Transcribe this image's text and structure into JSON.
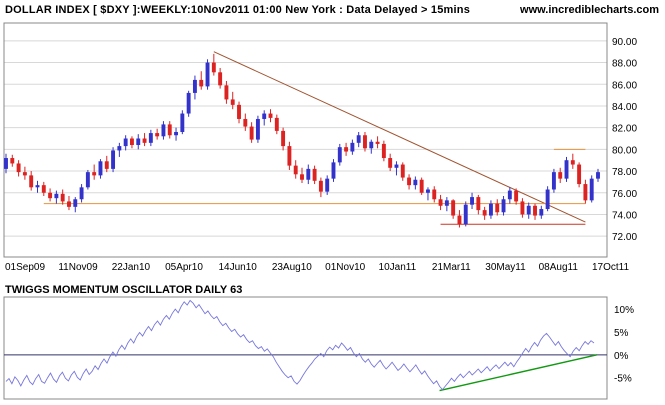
{
  "header": {
    "title": "DOLLAR INDEX [ $DXY ]:WEEKLY:10Nov2011 01:00 New York  : Data Delayed > 15mins",
    "site": "www.incrediblecharts.com"
  },
  "colors": {
    "up": "#3333cc",
    "down": "#dd2222",
    "trendline": "#a0522d",
    "support": "#e8923c",
    "oscillator": "#7777dd",
    "osc_trend": "#119911",
    "zero_line": "#333366",
    "grid": "#d8d8d8"
  },
  "chart_data": [
    {
      "type": "candlestick",
      "title": "DOLLAR INDEX [ $DXY ]:WEEKLY:10Nov2011 01:00 New York  : Data Delayed > 15mins",
      "x_tick_labels": [
        "01Sep09",
        "11Nov09",
        "22Jan10",
        "05Apr10",
        "14Jun10",
        "23Aug10",
        "01Nov10",
        "10Jan11",
        "21Mar11",
        "30May11",
        "08Aug11",
        "17Oct11"
      ],
      "y_tick_labels": [
        "72.00",
        "74.00",
        "76.00",
        "78.00",
        "80.00",
        "82.00",
        "84.00",
        "86.00",
        "88.00",
        "90.00"
      ],
      "ylim": [
        71,
        91
      ],
      "grid": true,
      "candles": [
        {
          "o": 78.2,
          "h": 79.6,
          "l": 77.8,
          "c": 79.2
        },
        {
          "o": 79.2,
          "h": 79.5,
          "l": 78.4,
          "c": 78.7
        },
        {
          "o": 78.7,
          "h": 79.0,
          "l": 77.5,
          "c": 77.9
        },
        {
          "o": 77.9,
          "h": 78.4,
          "l": 77.2,
          "c": 77.6
        },
        {
          "o": 77.6,
          "h": 78.0,
          "l": 76.2,
          "c": 76.5
        },
        {
          "o": 76.5,
          "h": 77.1,
          "l": 76.0,
          "c": 76.7
        },
        {
          "o": 76.7,
          "h": 77.0,
          "l": 75.7,
          "c": 76.0
        },
        {
          "o": 76.0,
          "h": 76.4,
          "l": 75.2,
          "c": 75.5
        },
        {
          "o": 75.5,
          "h": 76.2,
          "l": 75.0,
          "c": 75.9
        },
        {
          "o": 75.9,
          "h": 76.3,
          "l": 74.9,
          "c": 75.2
        },
        {
          "o": 75.2,
          "h": 75.7,
          "l": 74.4,
          "c": 74.7
        },
        {
          "o": 74.7,
          "h": 75.6,
          "l": 74.2,
          "c": 75.4
        },
        {
          "o": 75.4,
          "h": 76.8,
          "l": 75.1,
          "c": 76.5
        },
        {
          "o": 76.5,
          "h": 78.1,
          "l": 76.3,
          "c": 77.9
        },
        {
          "o": 77.9,
          "h": 78.6,
          "l": 77.2,
          "c": 77.6
        },
        {
          "o": 77.6,
          "h": 79.1,
          "l": 77.3,
          "c": 78.9
        },
        {
          "o": 78.9,
          "h": 79.4,
          "l": 77.9,
          "c": 78.2
        },
        {
          "o": 78.2,
          "h": 80.2,
          "l": 77.9,
          "c": 79.9
        },
        {
          "o": 79.9,
          "h": 80.6,
          "l": 79.3,
          "c": 80.3
        },
        {
          "o": 80.3,
          "h": 81.3,
          "l": 79.9,
          "c": 81.0
        },
        {
          "o": 81.0,
          "h": 81.2,
          "l": 80.1,
          "c": 80.4
        },
        {
          "o": 80.4,
          "h": 81.4,
          "l": 80.0,
          "c": 81.0
        },
        {
          "o": 81.0,
          "h": 81.5,
          "l": 80.3,
          "c": 80.6
        },
        {
          "o": 80.6,
          "h": 81.8,
          "l": 80.3,
          "c": 81.5
        },
        {
          "o": 81.5,
          "h": 81.9,
          "l": 80.9,
          "c": 81.2
        },
        {
          "o": 81.2,
          "h": 82.6,
          "l": 80.9,
          "c": 82.3
        },
        {
          "o": 82.3,
          "h": 82.6,
          "l": 81.0,
          "c": 81.3
        },
        {
          "o": 81.3,
          "h": 82.0,
          "l": 80.8,
          "c": 81.6
        },
        {
          "o": 81.6,
          "h": 83.6,
          "l": 81.4,
          "c": 83.3
        },
        {
          "o": 83.3,
          "h": 85.4,
          "l": 83.0,
          "c": 85.2
        },
        {
          "o": 85.2,
          "h": 86.8,
          "l": 84.6,
          "c": 86.4
        },
        {
          "o": 86.4,
          "h": 87.2,
          "l": 85.5,
          "c": 85.8
        },
        {
          "o": 85.8,
          "h": 88.3,
          "l": 85.5,
          "c": 88.0
        },
        {
          "o": 88.0,
          "h": 88.8,
          "l": 86.8,
          "c": 87.1
        },
        {
          "o": 87.1,
          "h": 87.5,
          "l": 85.6,
          "c": 85.9
        },
        {
          "o": 85.9,
          "h": 86.3,
          "l": 84.2,
          "c": 84.6
        },
        {
          "o": 84.6,
          "h": 85.3,
          "l": 83.7,
          "c": 84.1
        },
        {
          "o": 84.1,
          "h": 84.4,
          "l": 82.4,
          "c": 82.8
        },
        {
          "o": 82.8,
          "h": 83.3,
          "l": 81.7,
          "c": 82.1
        },
        {
          "o": 82.1,
          "h": 82.5,
          "l": 80.6,
          "c": 80.9
        },
        {
          "o": 80.9,
          "h": 83.1,
          "l": 80.6,
          "c": 82.8
        },
        {
          "o": 82.8,
          "h": 83.6,
          "l": 82.2,
          "c": 83.3
        },
        {
          "o": 83.3,
          "h": 83.7,
          "l": 82.5,
          "c": 82.9
        },
        {
          "o": 82.9,
          "h": 83.2,
          "l": 81.4,
          "c": 81.7
        },
        {
          "o": 81.7,
          "h": 82.0,
          "l": 79.9,
          "c": 80.3
        },
        {
          "o": 80.3,
          "h": 80.7,
          "l": 78.1,
          "c": 78.5
        },
        {
          "o": 78.5,
          "h": 79.0,
          "l": 77.3,
          "c": 77.7
        },
        {
          "o": 77.7,
          "h": 78.3,
          "l": 76.9,
          "c": 77.2
        },
        {
          "o": 77.2,
          "h": 78.6,
          "l": 76.8,
          "c": 78.2
        },
        {
          "o": 78.2,
          "h": 78.5,
          "l": 76.8,
          "c": 77.1
        },
        {
          "o": 77.1,
          "h": 77.4,
          "l": 75.6,
          "c": 76.1
        },
        {
          "o": 76.1,
          "h": 77.6,
          "l": 75.8,
          "c": 77.3
        },
        {
          "o": 77.3,
          "h": 79.1,
          "l": 77.0,
          "c": 78.8
        },
        {
          "o": 78.8,
          "h": 80.5,
          "l": 78.5,
          "c": 80.2
        },
        {
          "o": 80.2,
          "h": 80.6,
          "l": 79.4,
          "c": 79.8
        },
        {
          "o": 79.8,
          "h": 80.9,
          "l": 79.5,
          "c": 80.6
        },
        {
          "o": 80.6,
          "h": 81.6,
          "l": 80.2,
          "c": 81.3
        },
        {
          "o": 81.3,
          "h": 81.6,
          "l": 79.8,
          "c": 80.1
        },
        {
          "o": 80.1,
          "h": 80.9,
          "l": 79.6,
          "c": 80.7
        },
        {
          "o": 80.7,
          "h": 81.2,
          "l": 80.1,
          "c": 80.5
        },
        {
          "o": 80.5,
          "h": 80.8,
          "l": 78.9,
          "c": 79.2
        },
        {
          "o": 79.2,
          "h": 79.6,
          "l": 78.0,
          "c": 78.3
        },
        {
          "o": 78.3,
          "h": 78.9,
          "l": 77.6,
          "c": 78.6
        },
        {
          "o": 78.6,
          "h": 78.8,
          "l": 77.1,
          "c": 77.4
        },
        {
          "o": 77.4,
          "h": 77.7,
          "l": 76.3,
          "c": 76.7
        },
        {
          "o": 76.7,
          "h": 77.5,
          "l": 76.3,
          "c": 77.2
        },
        {
          "o": 77.2,
          "h": 77.4,
          "l": 75.8,
          "c": 76.0
        },
        {
          "o": 76.0,
          "h": 76.5,
          "l": 75.3,
          "c": 76.3
        },
        {
          "o": 76.3,
          "h": 76.6,
          "l": 75.1,
          "c": 75.4
        },
        {
          "o": 75.4,
          "h": 75.8,
          "l": 74.4,
          "c": 74.8
        },
        {
          "o": 74.8,
          "h": 75.6,
          "l": 74.3,
          "c": 75.3
        },
        {
          "o": 75.3,
          "h": 75.4,
          "l": 73.6,
          "c": 73.9
        },
        {
          "o": 73.9,
          "h": 74.4,
          "l": 72.8,
          "c": 73.1
        },
        {
          "o": 73.1,
          "h": 75.2,
          "l": 72.9,
          "c": 74.9
        },
        {
          "o": 74.9,
          "h": 76.0,
          "l": 74.5,
          "c": 75.6
        },
        {
          "o": 75.6,
          "h": 75.8,
          "l": 74.0,
          "c": 74.4
        },
        {
          "o": 74.4,
          "h": 74.7,
          "l": 73.5,
          "c": 73.9
        },
        {
          "o": 73.9,
          "h": 75.3,
          "l": 73.6,
          "c": 75.0
        },
        {
          "o": 75.0,
          "h": 75.4,
          "l": 73.9,
          "c": 74.2
        },
        {
          "o": 74.2,
          "h": 75.7,
          "l": 73.9,
          "c": 75.4
        },
        {
          "o": 75.4,
          "h": 76.5,
          "l": 75.0,
          "c": 76.2
        },
        {
          "o": 76.2,
          "h": 76.4,
          "l": 74.9,
          "c": 75.2
        },
        {
          "o": 75.2,
          "h": 75.5,
          "l": 73.7,
          "c": 74.0
        },
        {
          "o": 74.0,
          "h": 75.1,
          "l": 73.6,
          "c": 74.8
        },
        {
          "o": 74.8,
          "h": 75.0,
          "l": 73.5,
          "c": 73.9
        },
        {
          "o": 73.9,
          "h": 74.8,
          "l": 73.6,
          "c": 74.5
        },
        {
          "o": 74.5,
          "h": 76.6,
          "l": 74.3,
          "c": 76.3
        },
        {
          "o": 76.3,
          "h": 78.2,
          "l": 76.0,
          "c": 77.9
        },
        {
          "o": 77.9,
          "h": 78.3,
          "l": 76.9,
          "c": 77.3
        },
        {
          "o": 77.3,
          "h": 79.3,
          "l": 77.0,
          "c": 79.0
        },
        {
          "o": 79.0,
          "h": 79.6,
          "l": 78.2,
          "c": 78.6
        },
        {
          "o": 78.6,
          "h": 78.8,
          "l": 76.5,
          "c": 76.8
        },
        {
          "o": 76.8,
          "h": 77.2,
          "l": 75.0,
          "c": 75.3
        },
        {
          "o": 75.3,
          "h": 77.6,
          "l": 75.1,
          "c": 77.3
        },
        {
          "o": 77.3,
          "h": 78.2,
          "l": 77.0,
          "c": 77.9
        }
      ],
      "trendlines": [
        {
          "kind": "resistance",
          "from": {
            "index": 33,
            "value": 89.0
          },
          "to": {
            "index": 92,
            "value": 73.3
          }
        },
        {
          "kind": "support",
          "from": {
            "index": 6,
            "value": 75.0
          },
          "to": {
            "index": 92,
            "value": 75.0
          }
        },
        {
          "kind": "support",
          "from": {
            "index": 69,
            "value": 73.1
          },
          "to": {
            "index": 92,
            "value": 73.1
          }
        },
        {
          "kind": "resistance",
          "from": {
            "index": 87,
            "value": 80.0
          },
          "to": {
            "index": 92,
            "value": 80.0
          }
        }
      ]
    },
    {
      "type": "line",
      "title": "TWIGGS MOMENTUM OSCILLATOR DAILY 63",
      "y_tick_labels": [
        "10%",
        "5%",
        "0%",
        "-5%"
      ],
      "ylim": [
        -9,
        12
      ],
      "zero_line": true,
      "values": [
        -5.8,
        -5.2,
        -6.3,
        -4.8,
        -5.6,
        -6.8,
        -5.5,
        -4.5,
        -5.9,
        -6.5,
        -5.2,
        -4.3,
        -5.8,
        -6.2,
        -5.0,
        -4.0,
        -5.3,
        -6.0,
        -4.6,
        -3.8,
        -5.1,
        -5.7,
        -4.4,
        -3.6,
        -4.9,
        -5.5,
        -4.1,
        -3.1,
        -4.3,
        -3.6,
        -2.4,
        -3.2,
        -1.9,
        -0.9,
        -1.8,
        -0.4,
        0.6,
        -0.3,
        1.1,
        2.1,
        1.2,
        2.6,
        3.5,
        2.6,
        4.0,
        4.9,
        4.1,
        5.3,
        6.2,
        5.3,
        6.6,
        7.4,
        6.5,
        7.8,
        8.6,
        7.8,
        9.1,
        10.0,
        9.2,
        10.6,
        11.6,
        10.9,
        11.9,
        11.3,
        10.3,
        11.0,
        10.0,
        9.0,
        9.6,
        8.6,
        7.9,
        8.4,
        7.2,
        6.4,
        6.9,
        5.9,
        5.1,
        5.6,
        4.6,
        3.9,
        4.4,
        3.4,
        2.7,
        3.1,
        2.0,
        1.4,
        1.8,
        0.8,
        1.3,
        0.4,
        -0.4,
        -1.6,
        -2.6,
        -3.6,
        -4.4,
        -5.0,
        -4.6,
        -5.8,
        -6.4,
        -5.6,
        -4.5,
        -3.5,
        -2.6,
        -1.8,
        -0.9,
        -0.3,
        0.3,
        -0.4,
        0.9,
        1.7,
        1.1,
        2.1,
        1.5,
        2.6,
        1.9,
        1.0,
        1.6,
        0.4,
        -0.4,
        0.3,
        -0.9,
        -1.6,
        -0.9,
        -2.0,
        -2.7,
        -1.9,
        -1.2,
        -2.3,
        -3.1,
        -2.4,
        -1.6,
        -2.5,
        -3.4,
        -2.8,
        -2.0,
        -2.9,
        -3.7,
        -3.0,
        -2.2,
        -3.3,
        -4.2,
        -3.5,
        -4.6,
        -5.5,
        -6.3,
        -5.7,
        -6.9,
        -7.6,
        -6.8,
        -6.0,
        -5.1,
        -5.8,
        -4.9,
        -4.2,
        -5.0,
        -4.3,
        -3.6,
        -4.4,
        -3.8,
        -3.1,
        -3.9,
        -3.3,
        -2.6,
        -3.5,
        -2.8,
        -2.2,
        -3.0,
        -2.3,
        -1.6,
        -2.4,
        -1.7,
        -2.6,
        -1.5,
        -0.6,
        0.4,
        1.4,
        0.6,
        1.8,
        2.7,
        1.9,
        3.2,
        4.1,
        4.7,
        3.9,
        3.0,
        2.1,
        2.9,
        1.8,
        0.9,
        0.2,
        -0.4,
        0.8,
        1.6,
        0.9,
        2.0,
        2.9,
        2.3,
        3.1,
        2.6
      ],
      "trendlines": [
        {
          "kind": "support",
          "from": {
            "index": 146,
            "value": -7.8
          },
          "to": {
            "index": 199,
            "value": 0.0
          }
        }
      ]
    }
  ]
}
